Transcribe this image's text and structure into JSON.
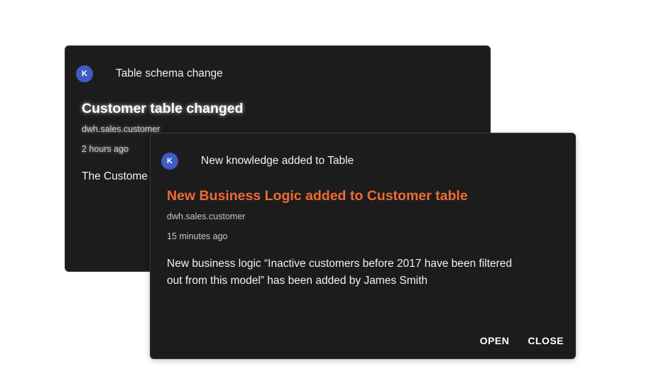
{
  "notifications": [
    {
      "avatar_initial": "K",
      "source": "Table schema change",
      "title": "Customer table changed",
      "path": "dwh.sales.customer",
      "time": "2 hours ago",
      "body": "The Custome"
    },
    {
      "avatar_initial": "K",
      "source": "New knowledge added to Table",
      "title": "New Business Logic added to Customer table",
      "path": "dwh.sales.customer",
      "time": "15 minutes ago",
      "body": "New business logic “Inactive customers before 2017 have been filtered out from this model” has been added by James Smith",
      "actions": {
        "open_label": "OPEN",
        "close_label": "CLOSE"
      }
    }
  ],
  "colors": {
    "card_background": "#1c1c1c",
    "avatar": "#3f5bc4",
    "title_accent": "#ee6b35"
  }
}
